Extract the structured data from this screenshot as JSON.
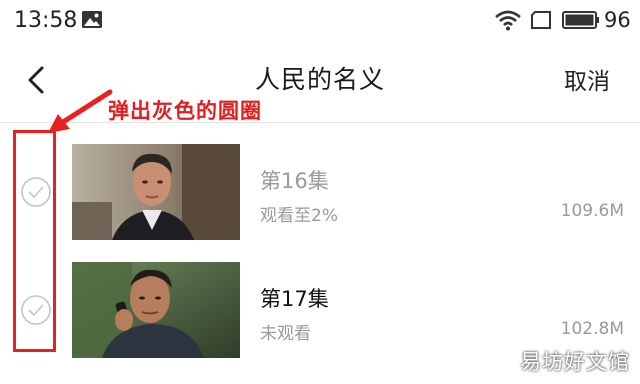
{
  "status_bar": {
    "time": "13:58",
    "battery_level": "96",
    "icons": [
      "gallery-icon",
      "wifi-icon",
      "sim-icon",
      "battery-icon"
    ]
  },
  "header": {
    "title": "人民的名义",
    "cancel_label": "取消",
    "back_icon": "chevron-left-icon"
  },
  "annotation": {
    "text": "弹出灰色的圆圈",
    "color": "#e02020"
  },
  "episodes": [
    {
      "title": "第16集",
      "status": "观看至2%",
      "size": "109.6M",
      "selected": false
    },
    {
      "title": "第17集",
      "status": "未观看",
      "size": "102.8M",
      "selected": false
    }
  ],
  "watermark": "易坊好文馆",
  "colors": {
    "accent_red": "#e82020",
    "muted_text": "#9a9a9a",
    "circle_gray": "#c4c4c4"
  }
}
